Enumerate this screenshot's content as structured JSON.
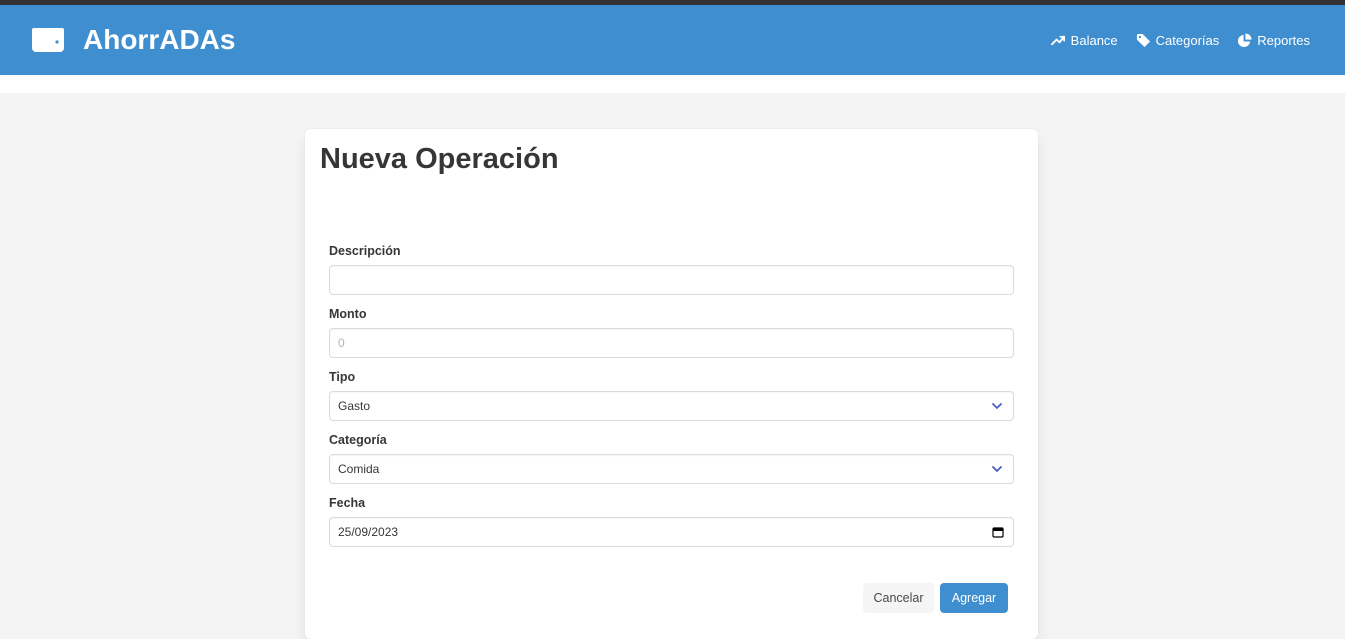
{
  "brand": {
    "title": "AhorrADAs",
    "icon": "wallet-icon"
  },
  "nav": {
    "items": [
      {
        "label": "Balance",
        "icon": "trending-up-icon"
      },
      {
        "label": "Categorías",
        "icon": "tag-icon"
      },
      {
        "label": "Reportes",
        "icon": "pie-chart-icon"
      }
    ]
  },
  "form": {
    "title": "Nueva Operación",
    "descripcion": {
      "label": "Descripción",
      "value": ""
    },
    "monto": {
      "label": "Monto",
      "placeholder": "0"
    },
    "tipo": {
      "label": "Tipo",
      "selected": "Gasto"
    },
    "categoria": {
      "label": "Categoría",
      "selected": "Comida"
    },
    "fecha": {
      "label": "Fecha",
      "value": "25/09/2023"
    },
    "cancel_label": "Cancelar",
    "submit_label": "Agregar"
  },
  "colors": {
    "primary": "#3e8ed0",
    "background": "#f4f4f4",
    "text": "#363636"
  }
}
